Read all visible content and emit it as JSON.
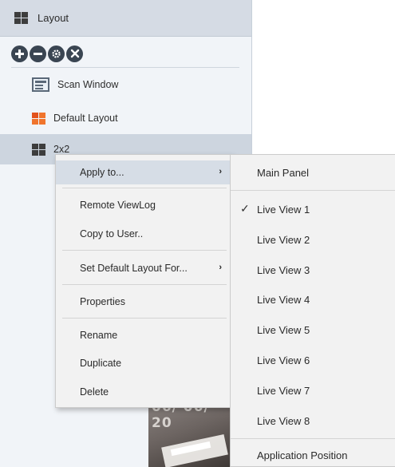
{
  "sidebar": {
    "header": {
      "icon": "layout-grid-icon",
      "title": "Layout"
    },
    "toolbar": [
      {
        "name": "add-layout-button",
        "icon": "plus-circle-icon",
        "glyph": "+"
      },
      {
        "name": "remove-layout-button",
        "icon": "minus-circle-icon",
        "glyph": "−"
      },
      {
        "name": "layout-settings-button",
        "icon": "gear-circle-icon",
        "glyph": "⚙"
      },
      {
        "name": "layout-tools-button",
        "icon": "tools-circle-icon",
        "glyph": "✕"
      }
    ],
    "items": [
      {
        "label": "Scan Window",
        "icon": "scan-window-icon"
      },
      {
        "label": "Default Layout",
        "icon": "default-layout-icon"
      },
      {
        "label": "2x2",
        "icon": "grid-2x2-icon",
        "selected": true
      }
    ]
  },
  "video_preview": {
    "timestamp_fragment": "06/ 06/ 20"
  },
  "context_menu": {
    "items": [
      {
        "label": "Apply to...",
        "has_submenu": true,
        "active": true
      },
      {
        "label": "Remote ViewLog"
      },
      {
        "label": "Copy to User.."
      },
      {
        "label": "Set Default Layout For...",
        "has_submenu": true
      },
      {
        "label": "Properties"
      },
      {
        "label": "Rename"
      },
      {
        "label": "Duplicate"
      },
      {
        "label": "Delete"
      }
    ],
    "submenu_arrow": "›"
  },
  "submenu": {
    "items": [
      {
        "label": "Main Panel"
      },
      {
        "label": "Live View 1",
        "checked": true
      },
      {
        "label": "Live View 2"
      },
      {
        "label": "Live View 3"
      },
      {
        "label": "Live View 4"
      },
      {
        "label": "Live View 5"
      },
      {
        "label": "Live View 6"
      },
      {
        "label": "Live View 7"
      },
      {
        "label": "Live View 8"
      },
      {
        "label": "Application Position"
      }
    ],
    "check_glyph": "✓"
  },
  "colors": {
    "header_bg": "#d5dbe4",
    "sidebar_bg": "#f1f4f8",
    "menu_bg": "#f2f2f2",
    "active_item_bg": "#d6dde6",
    "accent_orange": "#f0742c"
  }
}
